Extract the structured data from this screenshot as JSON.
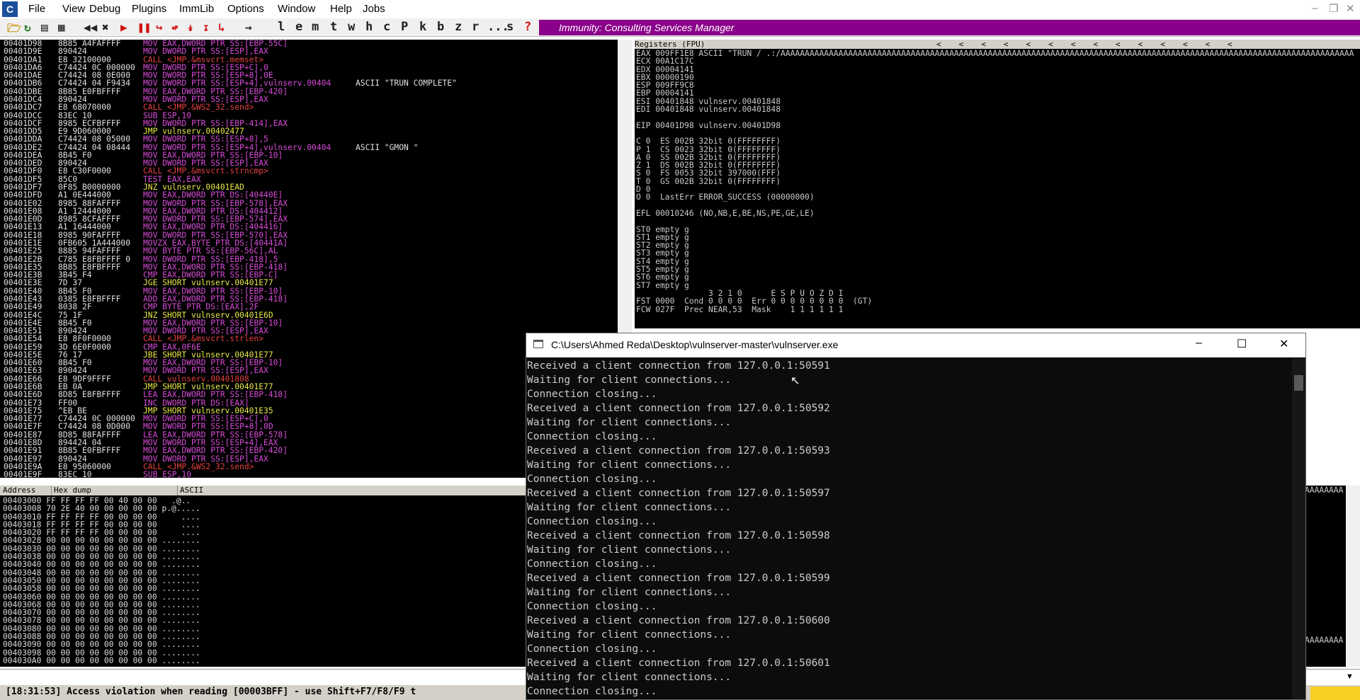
{
  "menubar": {
    "app_icon": "C",
    "items": [
      "File",
      "View",
      "Debug",
      "Plugins",
      "ImmLib",
      "Options",
      "Window",
      "Help",
      "Jobs"
    ]
  },
  "toolbar": {
    "letters": [
      "l",
      "e",
      "m",
      "t",
      "w",
      "h",
      "c",
      "P",
      "k",
      "b",
      "z",
      "r",
      "...",
      "s",
      "?"
    ],
    "banner": "Immunity: Consulting Services Manager"
  },
  "cpu": {
    "highlight_color": "#000080",
    "rows": [
      {
        "addr": "00401D98",
        "hex": "8B85 A4FAFFFF",
        "asm": "MOV EAX,DWORD PTR SS:[EBP-55C]",
        "cmt": ""
      },
      {
        "addr": "00401D9E",
        "hex": "890424",
        "asm": "MOV DWORD PTR SS:[ESP],EAX",
        "cmt": ""
      },
      {
        "addr": "00401DA1",
        "hex": "E8 32100000",
        "asm": "CALL <JMP.&msvcrt.memset>",
        "cmt": ""
      },
      {
        "addr": "00401DA6",
        "hex": "C74424 0C 000000",
        "asm": "MOV DWORD PTR SS:[ESP+C],0",
        "cmt": ""
      },
      {
        "addr": "00401DAE",
        "hex": "C74424 08 0E000",
        "asm": "MOV DWORD PTR SS:[ESP+8],0E",
        "cmt": ""
      },
      {
        "addr": "00401DB6",
        "hex": "C74424 04 F9434",
        "asm": "MOV DWORD PTR SS:[ESP+4],vulnserv.00404",
        "cmt": "ASCII \"TRUN COMPLETE\""
      },
      {
        "addr": "00401DBE",
        "hex": "8B85 E0FBFFFF",
        "asm": "MOV EAX,DWORD PTR SS:[EBP-420]",
        "cmt": ""
      },
      {
        "addr": "00401DC4",
        "hex": "890424",
        "asm": "MOV DWORD PTR SS:[ESP],EAX",
        "cmt": ""
      },
      {
        "addr": "00401DC7",
        "hex": "E8 68070000",
        "asm": "CALL <JMP.&WS2_32.send>",
        "cmt": ""
      },
      {
        "addr": "00401DCC",
        "hex": "83EC 10",
        "asm": "SUB ESP,10",
        "cmt": ""
      },
      {
        "addr": "00401DCF",
        "hex": "8985 ECFBFFFF",
        "asm": "MOV DWORD PTR SS:[EBP-414],EAX",
        "cmt": ""
      },
      {
        "addr": "00401DD5",
        "hex": "E9 9D060000",
        "asm": "JMP vulnserv.00402477",
        "cmt": ""
      },
      {
        "addr": "00401DDA",
        "hex": "C74424 08 05000",
        "asm": "MOV DWORD PTR SS:[ESP+8],5",
        "cmt": ""
      },
      {
        "addr": "00401DE2",
        "hex": "C74424 04 08444",
        "asm": "MOV DWORD PTR SS:[ESP+4],vulnserv.00404",
        "cmt": "ASCII \"GMON \""
      },
      {
        "addr": "00401DEA",
        "hex": "8B45 F0",
        "asm": "MOV EAX,DWORD PTR SS:[EBP-10]",
        "cmt": ""
      },
      {
        "addr": "00401DED",
        "hex": "890424",
        "asm": "MOV DWORD PTR SS:[ESP],EAX",
        "cmt": ""
      },
      {
        "addr": "00401DF0",
        "hex": "E8 C30F0000",
        "asm": "CALL <JMP.&msvcrt.strncmp>",
        "cmt": ""
      },
      {
        "addr": "00401DF5",
        "hex": "85C0",
        "asm": "TEST EAX,EAX",
        "cmt": ""
      },
      {
        "addr": "00401DF7",
        "hex": "0F85 B0000000",
        "asm": "JNZ vulnserv.00401EAD",
        "cmt": ""
      },
      {
        "addr": "00401DFD",
        "hex": "A1 0E444000",
        "asm": "MOV EAX,DWORD PTR DS:[40440E]",
        "cmt": ""
      },
      {
        "addr": "00401E02",
        "hex": "8985 88FAFFFF",
        "asm": "MOV DWORD PTR SS:[EBP-578],EAX",
        "cmt": ""
      },
      {
        "addr": "00401E08",
        "hex": "A1 12444000",
        "asm": "MOV EAX,DWORD PTR DS:[404412]",
        "cmt": ""
      },
      {
        "addr": "00401E0D",
        "hex": "8985 8CFAFFFF",
        "asm": "MOV DWORD PTR SS:[EBP-574],EAX",
        "cmt": ""
      },
      {
        "addr": "00401E13",
        "hex": "A1 16444000",
        "asm": "MOV EAX,DWORD PTR DS:[404416]",
        "cmt": ""
      },
      {
        "addr": "00401E18",
        "hex": "8985 90FAFFFF",
        "asm": "MOV DWORD PTR SS:[EBP-570],EAX",
        "cmt": ""
      },
      {
        "addr": "00401E1E",
        "hex": "0FB605 1A444000",
        "asm": "MOVZX EAX,BYTE PTR DS:[40441A]",
        "cmt": ""
      },
      {
        "addr": "00401E25",
        "hex": "8885 94FAFFFF",
        "asm": "MOV BYTE PTR SS:[EBP-56C],AL",
        "cmt": ""
      },
      {
        "addr": "00401E2B",
        "hex": "C785 E8FBFFFF 0",
        "asm": "MOV DWORD PTR SS:[EBP-418],5",
        "cmt": ""
      },
      {
        "addr": "00401E35",
        "hex": "8B85 E8FBFFFF",
        "asm": "MOV EAX,DWORD PTR SS:[EBP-418]",
        "cmt": ""
      },
      {
        "addr": "00401E3B",
        "hex": "3B45 F4",
        "asm": "CMP EAX,DWORD PTR SS:[EBP-C]",
        "cmt": ""
      },
      {
        "addr": "00401E3E",
        "hex": "7D 37",
        "asm": "JGE SHORT vulnserv.00401E77",
        "cmt": ""
      },
      {
        "addr": "00401E40",
        "hex": "8B45 F0",
        "asm": "MOV EAX,DWORD PTR SS:[EBP-10]",
        "cmt": ""
      },
      {
        "addr": "00401E43",
        "hex": "0385 E8FBFFFF",
        "asm": "ADD EAX,DWORD PTR SS:[EBP-418]",
        "cmt": ""
      },
      {
        "addr": "00401E49",
        "hex": "8038 2F",
        "asm": "CMP BYTE PTR DS:[EAX],2F",
        "cmt": ""
      },
      {
        "addr": "00401E4C",
        "hex": "75 1F",
        "asm": "JNZ SHORT vulnserv.00401E6D",
        "cmt": ""
      },
      {
        "addr": "00401E4E",
        "hex": "8B45 F0",
        "asm": "MOV EAX,DWORD PTR SS:[EBP-10]",
        "cmt": ""
      },
      {
        "addr": "00401E51",
        "hex": "890424",
        "asm": "MOV DWORD PTR SS:[ESP],EAX",
        "cmt": ""
      },
      {
        "addr": "00401E54",
        "hex": "E8 8F0F0000",
        "asm": "CALL <JMP.&msvcrt.strlen>",
        "cmt": ""
      },
      {
        "addr": "00401E59",
        "hex": "3D 6E0F0000",
        "asm": "CMP EAX,0F6E",
        "cmt": ""
      },
      {
        "addr": "00401E5E",
        "hex": "76 17",
        "asm": "JBE SHORT vulnserv.00401E77",
        "cmt": ""
      },
      {
        "addr": "00401E60",
        "hex": "8B45 F0",
        "asm": "MOV EAX,DWORD PTR SS:[EBP-10]",
        "cmt": ""
      },
      {
        "addr": "00401E63",
        "hex": "890424",
        "asm": "MOV DWORD PTR SS:[ESP],EAX",
        "cmt": ""
      },
      {
        "addr": "00401E66",
        "hex": "E8 9DF9FFFF",
        "asm": "CALL vulnserv.00401808",
        "cmt": ""
      },
      {
        "addr": "00401E6B",
        "hex": "EB 0A",
        "asm": "JMP SHORT vulnserv.00401E77",
        "cmt": ""
      },
      {
        "addr": "00401E6D",
        "hex": "8D85 E8FBFFFF",
        "asm": "LEA EAX,DWORD PTR SS:[EBP-418]",
        "cmt": ""
      },
      {
        "addr": "00401E73",
        "hex": "FF00",
        "asm": "INC DWORD PTR DS:[EAX]",
        "cmt": ""
      },
      {
        "addr": "00401E75",
        "hex": "^EB BE",
        "asm": "JMP SHORT vulnserv.00401E35",
        "cmt": ""
      },
      {
        "addr": "00401E77",
        "hex": "C74424 0C 000000",
        "asm": "MOV DWORD PTR SS:[ESP+C],0",
        "cmt": ""
      },
      {
        "addr": "00401E7F",
        "hex": "C74424 08 0D000",
        "asm": "MOV DWORD PTR SS:[ESP+8],0D",
        "cmt": ""
      },
      {
        "addr": "00401E87",
        "hex": "8D85 88FAFFFF",
        "asm": "LEA EAX,DWORD PTR SS:[EBP-578]",
        "cmt": ""
      },
      {
        "addr": "00401E8D",
        "hex": "894424 04",
        "asm": "MOV DWORD PTR SS:[ESP+4],EAX",
        "cmt": ""
      },
      {
        "addr": "00401E91",
        "hex": "8B85 E0FBFFFF",
        "asm": "MOV EAX,DWORD PTR SS:[EBP-420]",
        "cmt": ""
      },
      {
        "addr": "00401E97",
        "hex": "890424",
        "asm": "MOV DWORD PTR SS:[ESP],EAX",
        "cmt": ""
      },
      {
        "addr": "00401E9A",
        "hex": "E8 95060000",
        "asm": "CALL <JMP.&WS2_32.send>",
        "cmt": ""
      },
      {
        "addr": "00401E9F",
        "hex": "83EC 10",
        "asm": "SUB ESP,10",
        "cmt": ""
      }
    ]
  },
  "registers": {
    "header": "Registers (FPU)",
    "lines": [
      "EAX 009FF1E8 ASCII \"TRUN / .:/AAAAAAAAAAAAAAAAAAAAAAAAAAAAAAAAAAAAAAAAAAAAAAAAAAAAAAAAAAAAAAAAAAAAAAAAAAAAAAAAAAAAAAAAAAAAAAAAAAAAAAAAAAAAAAAAAAAAAAA",
      "ECX 00A1C17C",
      "EDX 00004141",
      "EBX 00000190",
      "ESP 009FF9C8",
      "EBP 00004141",
      "ESI 00401848 vulnserv.00401848",
      "EDI 00401848 vulnserv.00401848",
      "",
      "EIP 00401D98 vulnserv.00401D98",
      "",
      "C 0  ES 002B 32bit 0(FFFFFFFF)",
      "P 1  CS 0023 32bit 0(FFFFFFFF)",
      "A 0  SS 002B 32bit 0(FFFFFFFF)",
      "Z 1  DS 002B 32bit 0(FFFFFFFF)",
      "S 0  FS 0053 32bit 397000(FFF)",
      "T 0  GS 002B 32bit 0(FFFFFFFF)",
      "D 0",
      "O 0  LastErr ERROR_SUCCESS (00000000)",
      "",
      "EFL 00010246 (NO,NB,E,BE,NS,PE,GE,LE)",
      "",
      "ST0 empty g",
      "ST1 empty g",
      "ST2 empty g",
      "ST3 empty g",
      "ST4 empty g",
      "ST5 empty g",
      "ST6 empty g",
      "ST7 empty g",
      "               3 2 1 0      E S P U O Z D I",
      "FST 0000  Cond 0 0 0 0  Err 0 0 0 0 0 0 0 0  (GT)",
      "FCW 027F  Prec NEAR,53  Mask    1 1 1 1 1 1"
    ]
  },
  "dump": {
    "headers": [
      "Address",
      "Hex dump",
      "ASCII"
    ],
    "rows": [
      "00403000 FF FF FF FF 00 40 00 00   .@..",
      "00403008 70 2E 40 00 00 00 00 00 p.@.....",
      "00403010 FF FF FF FF 00 00 00 00     ....",
      "00403018 FF FF FF FF 00 00 00 00     ....",
      "00403020 FF FF FF FF 00 00 00 00     ....",
      "00403028 00 00 00 00 00 00 00 00 ........",
      "00403030 00 00 00 00 00 00 00 00 ........",
      "00403038 00 00 00 00 00 00 00 00 ........",
      "00403040 00 00 00 00 00 00 00 00 ........",
      "00403048 00 00 00 00 00 00 00 00 ........",
      "00403050 00 00 00 00 00 00 00 00 ........",
      "00403058 00 00 00 00 00 00 00 00 ........",
      "00403060 00 00 00 00 00 00 00 00 ........",
      "00403068 00 00 00 00 00 00 00 00 ........",
      "00403070 00 00 00 00 00 00 00 00 ........",
      "00403078 00 00 00 00 00 00 00 00 ........",
      "00403080 00 00 00 00 00 00 00 00 ........",
      "00403088 00 00 00 00 00 00 00 00 ........",
      "00403090 00 00 00 00 00 00 00 00 ........",
      "00403098 00 00 00 00 00 00 00 00 ........",
      "004030A0 00 00 00 00 00 00 00 00 ........"
    ]
  },
  "stack": {
    "lines": [
      "AAAAAAAA",
      "AAAAAAAA"
    ]
  },
  "status": {
    "text": "[18:31:53] Access violation when reading [00003BFF] - use Shift+F7/F8/F9 t"
  },
  "console": {
    "title": "C:\\Users\\Ahmed Reda\\Desktop\\vulnserver-master\\vulnserver.exe",
    "lines": [
      "Received a client connection from 127.0.0.1:50591",
      "Waiting for client connections...",
      "Connection closing...",
      "Received a client connection from 127.0.0.1:50592",
      "Waiting for client connections...",
      "Connection closing...",
      "Received a client connection from 127.0.0.1:50593",
      "Waiting for client connections...",
      "Connection closing...",
      "Received a client connection from 127.0.0.1:50597",
      "Waiting for client connections...",
      "Connection closing...",
      "Received a client connection from 127.0.0.1:50598",
      "Waiting for client connections...",
      "Connection closing...",
      "Received a client connection from 127.0.0.1:50599",
      "Waiting for client connections...",
      "Connection closing...",
      "Received a client connection from 127.0.0.1:50600",
      "Waiting for client connections...",
      "Connection closing...",
      "Received a client connection from 127.0.0.1:50601",
      "Waiting for client connections...",
      "Connection closing..."
    ]
  }
}
